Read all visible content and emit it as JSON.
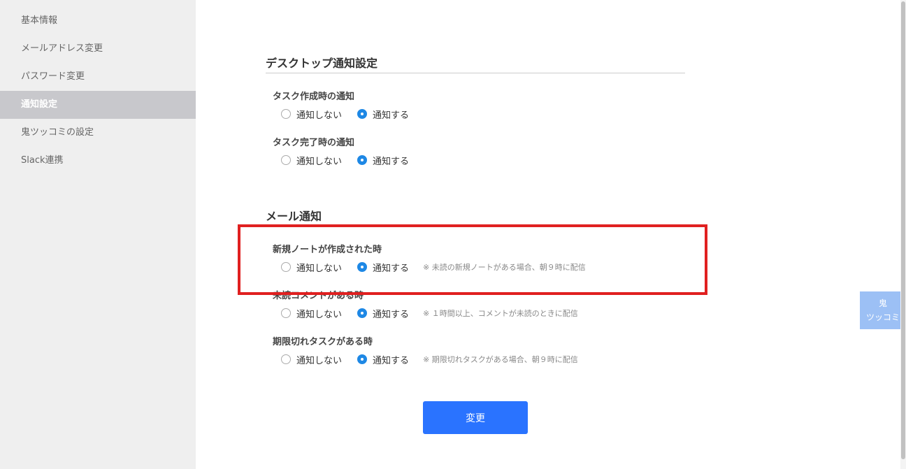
{
  "sidebar": {
    "items": [
      {
        "label": "基本情報"
      },
      {
        "label": "メールアドレス変更"
      },
      {
        "label": "パスワード変更"
      },
      {
        "label": "通知設定"
      },
      {
        "label": "鬼ツッコミの設定"
      },
      {
        "label": "Slack連携"
      }
    ],
    "active_index": 3
  },
  "desktop": {
    "title": "デスクトップ通知設定",
    "settings": [
      {
        "label": "タスク作成時の通知",
        "off": "通知しない",
        "on": "通知する",
        "selected": "on"
      },
      {
        "label": "タスク完了時の通知",
        "off": "通知しない",
        "on": "通知する",
        "selected": "on"
      }
    ]
  },
  "mail": {
    "title": "メール通知",
    "settings": [
      {
        "label": "新規ノートが作成された時",
        "off": "通知しない",
        "on": "通知する",
        "selected": "on",
        "note": "※ 未読の新規ノートがある場合、朝９時に配信"
      },
      {
        "label": "未読コメントがある時",
        "off": "通知しない",
        "on": "通知する",
        "selected": "on",
        "note": "※ １時間以上、コメントが未読のときに配信"
      },
      {
        "label": "期限切れタスクがある時",
        "off": "通知しない",
        "on": "通知する",
        "selected": "on",
        "note": "※ 期限切れタスクがある場合、朝９時に配信"
      }
    ]
  },
  "submit_label": "変更",
  "float_button": {
    "line1": "鬼",
    "line2": "ツッコミ"
  },
  "colors": {
    "accent": "#2a73ff",
    "radio_checked": "#1e88e5",
    "highlight": "#e02020",
    "sidebar_bg": "#efefef",
    "sidebar_active": "#c8c8cc",
    "float_button": "#9cc0f5"
  }
}
